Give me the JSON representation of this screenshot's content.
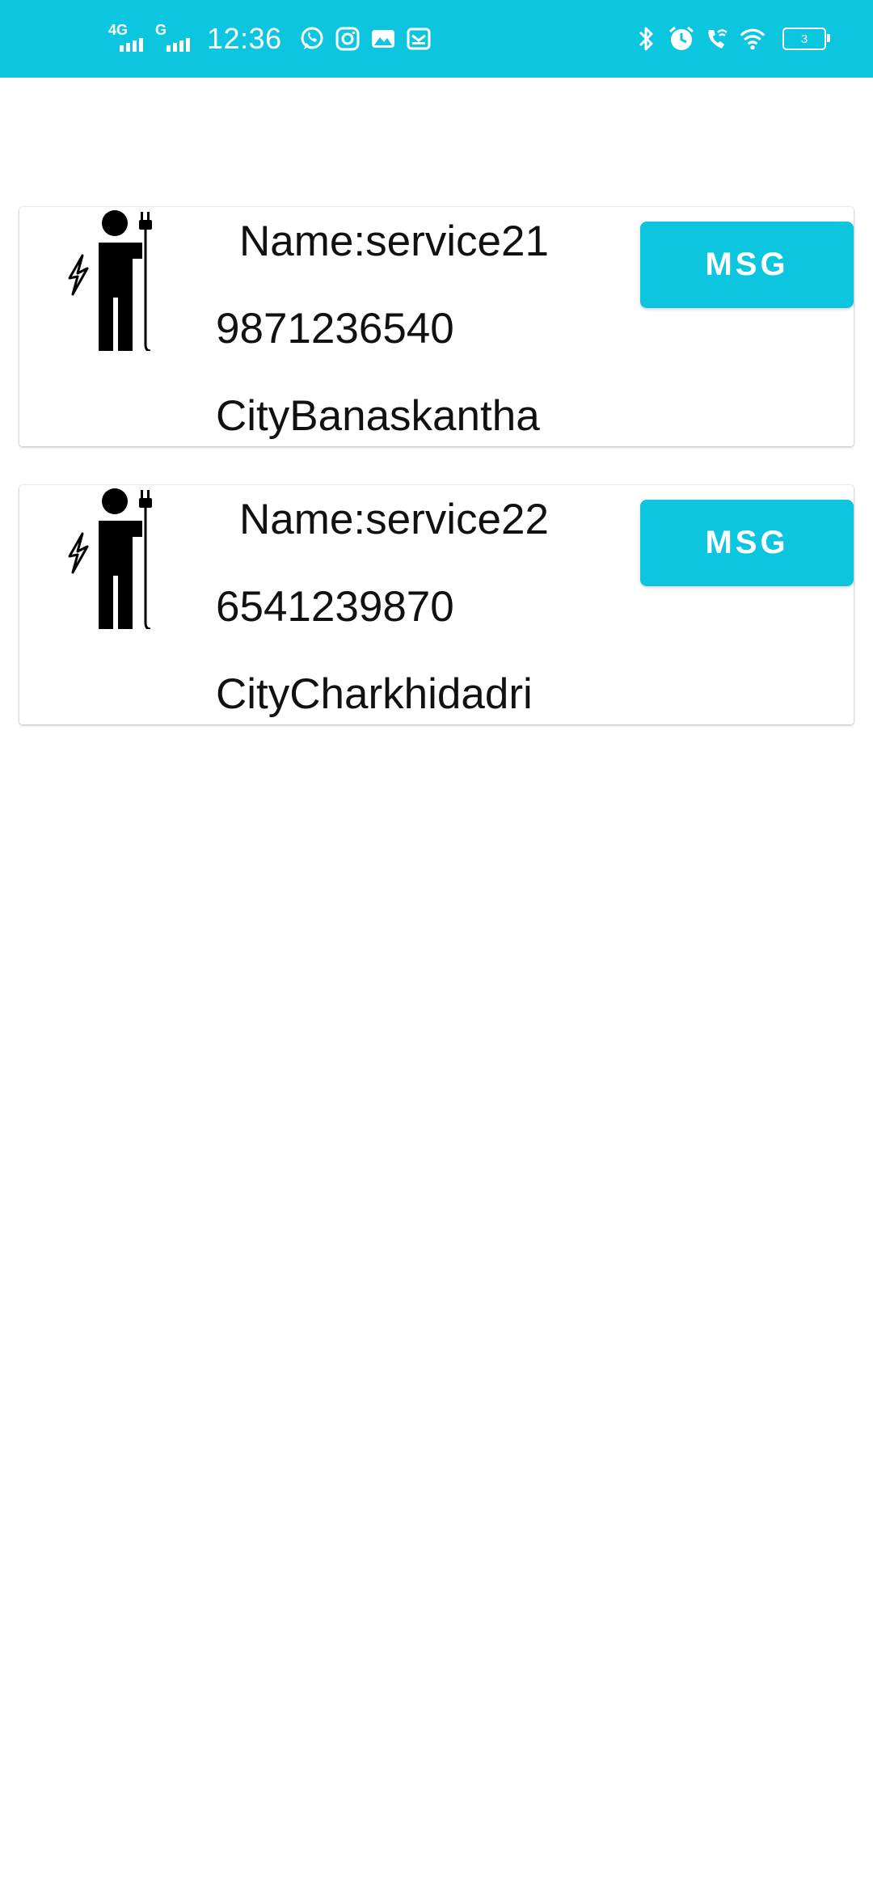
{
  "status_bar": {
    "network_1": "4G",
    "network_2": "G",
    "time": "12:36",
    "battery": "3",
    "background_color": "#0cc5df",
    "left_icons": [
      "whatsapp-icon",
      "instagram-icon",
      "gallery-icon",
      "mail-icon"
    ],
    "right_icons": [
      "bluetooth-icon",
      "alarm-icon",
      "wifi-calling-icon",
      "wifi-icon",
      "battery-icon"
    ]
  },
  "services": [
    {
      "name": "Name:service21",
      "phone": "9871236540",
      "city": "CityBanaskantha",
      "button": "MSG",
      "icon": "electrician-icon"
    },
    {
      "name": "Name:service22",
      "phone": "6541239870",
      "city": "CityCharkhidadri",
      "button": "MSG",
      "icon": "electrician-icon"
    }
  ],
  "accent_color": "#0cc5df"
}
